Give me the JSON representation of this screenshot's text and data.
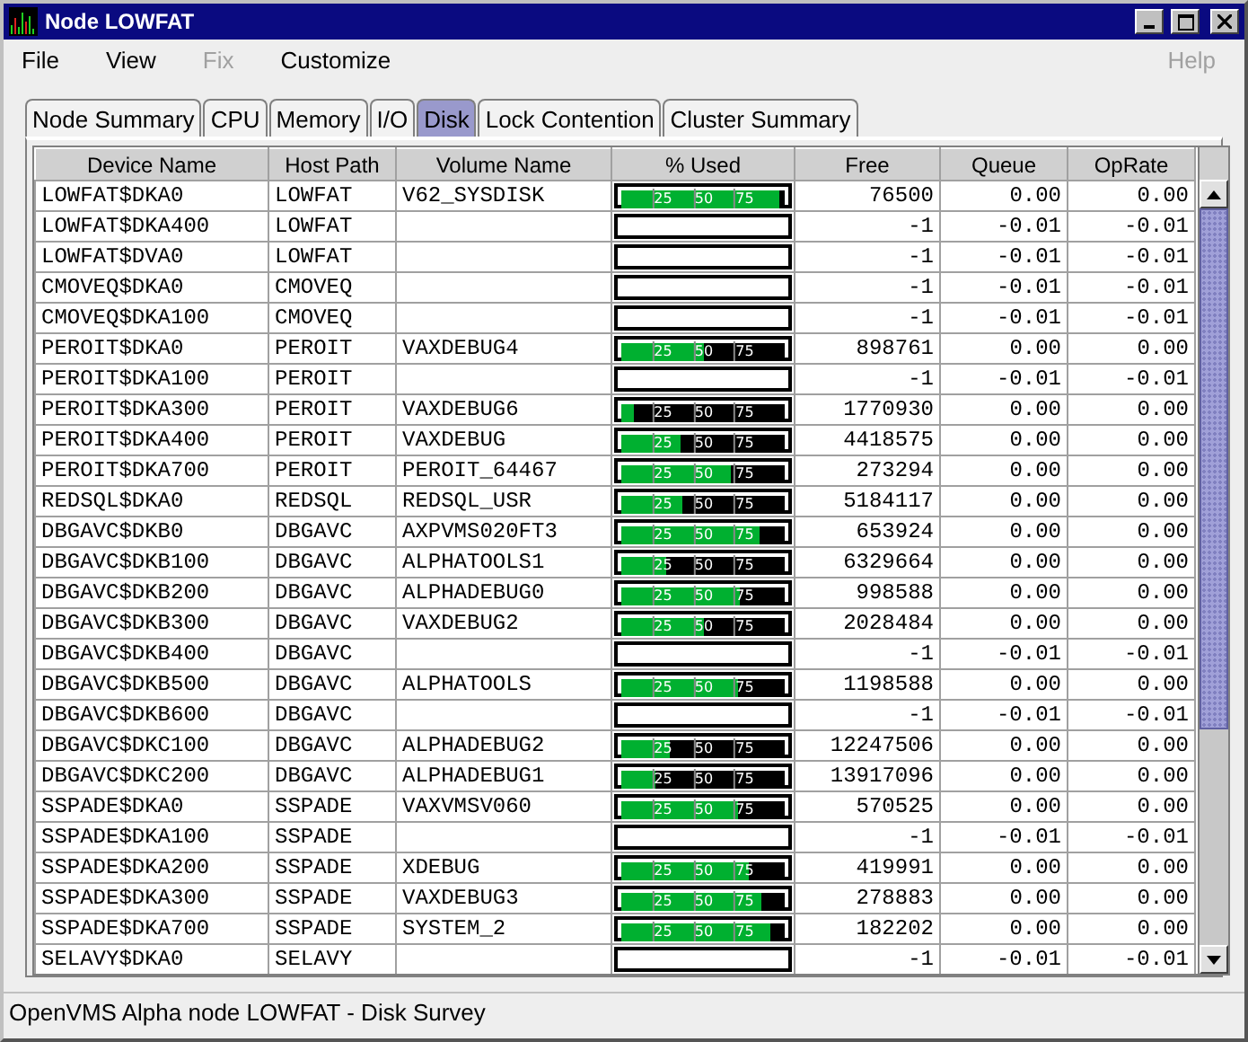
{
  "window": {
    "title": "Node LOWFAT"
  },
  "menu": [
    {
      "label": "File",
      "disabled": false
    },
    {
      "label": "View",
      "disabled": false
    },
    {
      "label": "Fix",
      "disabled": true
    },
    {
      "label": "Customize",
      "disabled": false
    }
  ],
  "help_menu": {
    "label": "Help",
    "disabled": true
  },
  "tabs": [
    {
      "label": "Node Summary",
      "selected": false
    },
    {
      "label": "CPU",
      "selected": false
    },
    {
      "label": "Memory",
      "selected": false
    },
    {
      "label": "I/O",
      "selected": false
    },
    {
      "label": "Disk",
      "selected": true
    },
    {
      "label": "Lock Contention",
      "selected": false
    },
    {
      "label": "Cluster Summary",
      "selected": false
    }
  ],
  "table": {
    "columns": [
      "Device Name",
      "Host Path",
      "Volume Name",
      "% Used",
      "Free",
      "Queue",
      "OpRate"
    ],
    "rows": [
      {
        "device": "LOWFAT$DKA0",
        "host": "LOWFAT",
        "volume": "V62_SYSDISK",
        "level": 0.97,
        "ticks": [
          "25",
          "50",
          "75"
        ],
        "free": "76500",
        "queue": "0.00",
        "oprate": "0.00"
      },
      {
        "device": "LOWFAT$DKA400",
        "host": "LOWFAT",
        "volume": "",
        "free": "-1",
        "queue": "-0.01",
        "oprate": "-0.01"
      },
      {
        "device": "LOWFAT$DVA0",
        "host": "LOWFAT",
        "volume": "",
        "free": "-1",
        "queue": "-0.01",
        "oprate": "-0.01"
      },
      {
        "device": "CMOVEQ$DKA0",
        "host": "CMOVEQ",
        "volume": "",
        "free": "-1",
        "queue": "-0.01",
        "oprate": "-0.01"
      },
      {
        "device": "CMOVEQ$DKA100",
        "host": "CMOVEQ",
        "volume": "",
        "free": "-1",
        "queue": "-0.01",
        "oprate": "-0.01"
      },
      {
        "device": "PEROIT$DKA0",
        "host": "PEROIT",
        "volume": "VAXDEBUG4",
        "level": 0.5,
        "ticks": [
          "25",
          "50",
          "75"
        ],
        "free": "898761",
        "queue": "0.00",
        "oprate": "0.00"
      },
      {
        "device": "PEROIT$DKA100",
        "host": "PEROIT",
        "volume": "",
        "free": "-1",
        "queue": "-0.01",
        "oprate": "-0.01"
      },
      {
        "device": "PEROIT$DKA300",
        "host": "PEROIT",
        "volume": "VAXDEBUG6",
        "level": 0.08,
        "ticks": [
          "25",
          "50",
          "75"
        ],
        "free": "1770930",
        "queue": "0.00",
        "oprate": "0.00"
      },
      {
        "device": "PEROIT$DKA400",
        "host": "PEROIT",
        "volume": "VAXDEBUG",
        "level": 0.36,
        "ticks": [
          "25",
          "50",
          "75"
        ],
        "free": "4418575",
        "queue": "0.00",
        "oprate": "0.00"
      },
      {
        "device": "PEROIT$DKA700",
        "host": "PEROIT",
        "volume": "PEROIT_64467",
        "level": 0.67,
        "ticks": [
          "25",
          "50",
          "75"
        ],
        "free": "273294",
        "queue": "0.00",
        "oprate": "0.00"
      },
      {
        "device": "REDSQL$DKA0",
        "host": "REDSQL",
        "volume": "REDSQL_USR",
        "level": 0.37,
        "ticks": [
          "25",
          "50",
          "75"
        ],
        "free": "5184117",
        "queue": "0.00",
        "oprate": "0.00"
      },
      {
        "device": "DBGAVC$DKB0",
        "host": "DBGAVC",
        "volume": "AXPVMS020FT3",
        "level": 0.85,
        "ticks": [
          "25",
          "50",
          "75"
        ],
        "free": "653924",
        "queue": "0.00",
        "oprate": "0.00"
      },
      {
        "device": "DBGAVC$DKB100",
        "host": "DBGAVC",
        "volume": "ALPHATOOLS1",
        "level": 0.27,
        "ticks": [
          "25",
          "50",
          "75"
        ],
        "free": "6329664",
        "queue": "0.00",
        "oprate": "0.00"
      },
      {
        "device": "DBGAVC$DKB200",
        "host": "DBGAVC",
        "volume": "ALPHADEBUG0",
        "level": 0.73,
        "ticks": [
          "25",
          "50",
          "75"
        ],
        "free": "998588",
        "queue": "0.00",
        "oprate": "0.00"
      },
      {
        "device": "DBGAVC$DKB300",
        "host": "DBGAVC",
        "volume": "VAXDEBUG2",
        "level": 0.51,
        "ticks": [
          "25",
          "50",
          "75"
        ],
        "free": "2028484",
        "queue": "0.00",
        "oprate": "0.00"
      },
      {
        "device": "DBGAVC$DKB400",
        "host": "DBGAVC",
        "volume": "",
        "free": "-1",
        "queue": "-0.01",
        "oprate": "-0.01"
      },
      {
        "device": "DBGAVC$DKB500",
        "host": "DBGAVC",
        "volume": "ALPHATOOLS",
        "level": 0.71,
        "ticks": [
          "25",
          "50",
          "75"
        ],
        "free": "1198588",
        "queue": "0.00",
        "oprate": "0.00"
      },
      {
        "device": "DBGAVC$DKB600",
        "host": "DBGAVC",
        "volume": "",
        "free": "-1",
        "queue": "-0.01",
        "oprate": "-0.01"
      },
      {
        "device": "DBGAVC$DKC100",
        "host": "DBGAVC",
        "volume": "ALPHADEBUG2",
        "level": 0.3,
        "ticks": [
          "25",
          "50",
          "75"
        ],
        "free": "12247506",
        "queue": "0.00",
        "oprate": "0.00"
      },
      {
        "device": "DBGAVC$DKC200",
        "host": "DBGAVC",
        "volume": "ALPHADEBUG1",
        "level": 0.21,
        "ticks": [
          "25",
          "50",
          "75"
        ],
        "free": "13917096",
        "queue": "0.00",
        "oprate": "0.00"
      },
      {
        "device": "SSPADE$DKA0",
        "host": "SSPADE",
        "volume": "VAXVMSV060",
        "level": 0.71,
        "ticks": [
          "25",
          "50",
          "75"
        ],
        "free": "570525",
        "queue": "0.00",
        "oprate": "0.00"
      },
      {
        "device": "SSPADE$DKA100",
        "host": "SSPADE",
        "volume": "",
        "free": "-1",
        "queue": "-0.01",
        "oprate": "-0.01"
      },
      {
        "device": "SSPADE$DKA200",
        "host": "SSPADE",
        "volume": "XDEBUG",
        "level": 0.78,
        "ticks": [
          "25",
          "50",
          "75"
        ],
        "free": "419991",
        "queue": "0.00",
        "oprate": "0.00"
      },
      {
        "device": "SSPADE$DKA300",
        "host": "SSPADE",
        "volume": "VAXDEBUG3",
        "level": 0.86,
        "ticks": [
          "25",
          "50",
          "75"
        ],
        "free": "278883",
        "queue": "0.00",
        "oprate": "0.00"
      },
      {
        "device": "SSPADE$DKA700",
        "host": "SSPADE",
        "volume": "SYSTEM_2",
        "level": 0.91,
        "ticks": [
          "25",
          "50",
          "75"
        ],
        "free": "182202",
        "queue": "0.00",
        "oprate": "0.00"
      },
      {
        "device": "SELAVY$DKA0",
        "host": "SELAVY",
        "volume": "",
        "free": "-1",
        "queue": "-0.01",
        "oprate": "-0.01"
      }
    ]
  },
  "status_bar": "OpenVMS Alpha node LOWFAT - Disk Survey"
}
